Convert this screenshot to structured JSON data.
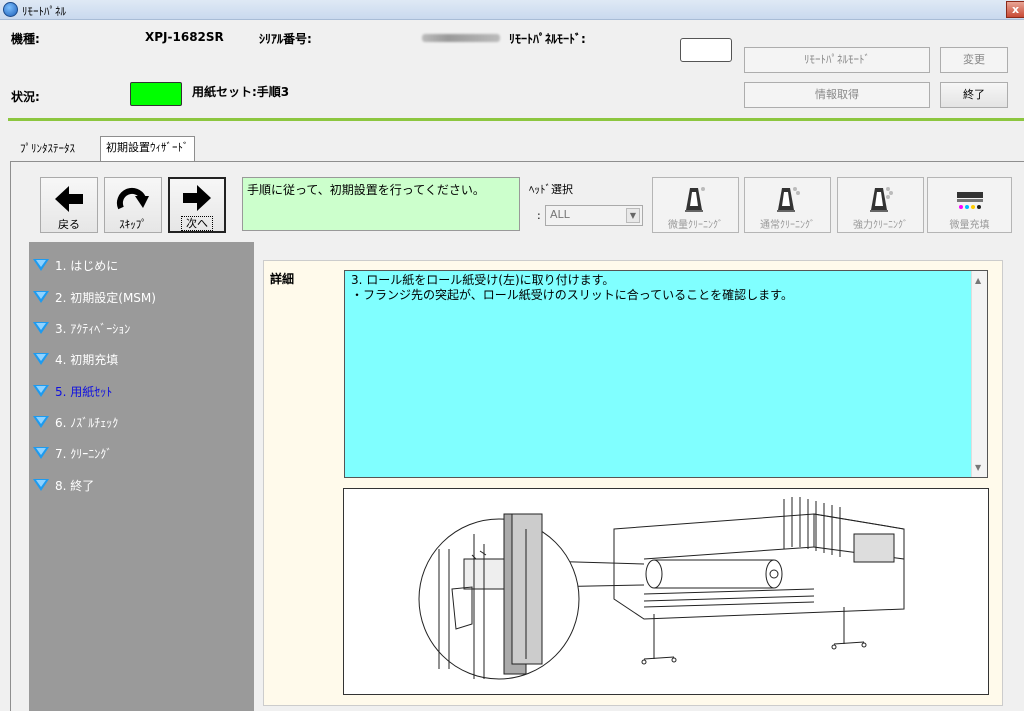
{
  "window": {
    "title": "ﾘﾓｰﾄﾊﾟﾈﾙ",
    "close_glyph": "x"
  },
  "header": {
    "model_label": "機種:",
    "model_value": "XPJ-1682SR",
    "serial_label": "ｼﾘｱﾙ番号:",
    "remote_mode_label": "ﾘﾓｰﾄﾊﾟﾈﾙﾓｰﾄﾞ:",
    "status_label": "状況:",
    "status_text": "用紙セット:手順3",
    "status_color": "#00ff00"
  },
  "top_buttons": {
    "remote_mode": "ﾘﾓｰﾄﾊﾟﾈﾙﾓｰﾄﾞ",
    "change": "変更",
    "get_info": "情報取得",
    "exit": "終了"
  },
  "tabs": [
    {
      "label": "ﾌﾟﾘﾝﾀｽﾃｰﾀｽ",
      "active": false
    },
    {
      "label": "初期設置ｳｨｻﾞｰﾄﾞ",
      "active": true
    }
  ],
  "nav": {
    "back": "戻る",
    "skip": "ｽｷｯﾌﾟ",
    "next": "次へ"
  },
  "instruction": "手順に従って、初期設置を行ってください。",
  "head_select": {
    "label": "ﾍｯﾄﾞ選択",
    "colon": ":",
    "value": "ALL"
  },
  "cleaning_buttons": [
    "微量ｸﾘｰﾆﾝｸﾞ",
    "通常ｸﾘｰﾆﾝｸﾞ",
    "強力ｸﾘｰﾆﾝｸﾞ",
    "微量充填"
  ],
  "steps": [
    {
      "label": "1. はじめに",
      "current": false
    },
    {
      "label": "2. 初期設定(MSM)",
      "current": false
    },
    {
      "label": "3. ｱｸﾃｨﾍﾞｰｼｮﾝ",
      "current": false
    },
    {
      "label": "4. 初期充填",
      "current": false
    },
    {
      "label": "5. 用紙ｾｯﾄ",
      "current": true
    },
    {
      "label": "6. ﾉｽﾞﾙﾁｪｯｸ",
      "current": false
    },
    {
      "label": "7. ｸﾘｰﾆﾝｸﾞ",
      "current": false
    },
    {
      "label": "8. 終了",
      "current": false
    }
  ],
  "detail": {
    "label": "詳細",
    "line1": "3. ロール紙をロール紙受け(左)に取り付けます。",
    "line2": "・フランジ先の突起が、ロール紙受けのスリットに合っていることを確認します。"
  },
  "colors": {
    "accent_green": "#8cc63f",
    "step_current": "#1010e0",
    "sidebar": "#9a9a9a",
    "detail_bg": "#80ffff"
  }
}
